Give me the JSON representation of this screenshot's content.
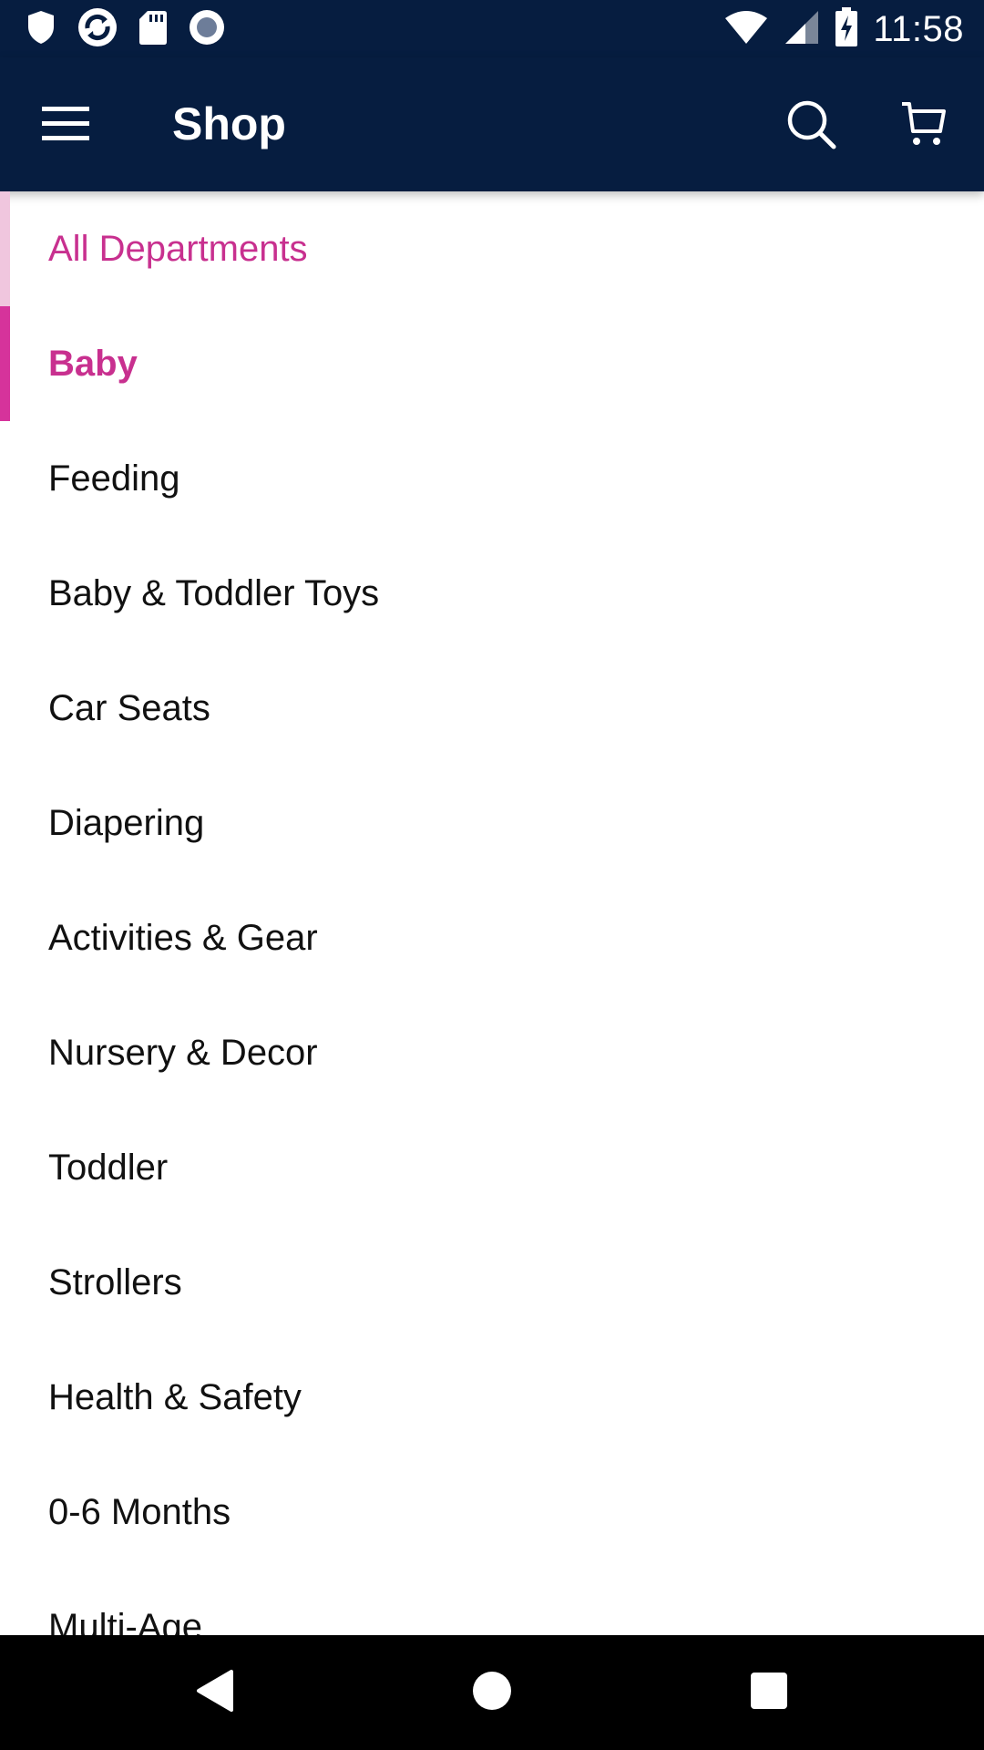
{
  "status_bar": {
    "time": "11:58",
    "left_icons": [
      "shield-icon",
      "sync-icon",
      "sd-card-icon",
      "record-icon"
    ],
    "right_icons": [
      "wifi-icon",
      "cell-signal-icon",
      "battery-charging-icon"
    ]
  },
  "app_bar": {
    "title": "Shop",
    "menu_icon": "hamburger-menu-icon",
    "search_icon": "search-icon",
    "cart_icon": "cart-icon"
  },
  "departments": {
    "back_label": "All Departments",
    "current_label": "Baby",
    "items": [
      "Feeding",
      "Baby & Toddler Toys",
      "Car Seats",
      "Diapering",
      "Activities & Gear",
      "Nursery & Decor",
      "Toddler",
      "Strollers",
      "Health & Safety",
      "0-6 Months",
      "Multi-Age"
    ]
  },
  "nav_bar": {
    "back_icon": "back-triangle-icon",
    "home_icon": "home-circle-icon",
    "recents_icon": "recents-square-icon"
  },
  "colors": {
    "header_bg": "#061d40",
    "accent": "#c8308f",
    "accent_bar": "#d6339b",
    "accent_bar_light": "#f0c6de"
  }
}
